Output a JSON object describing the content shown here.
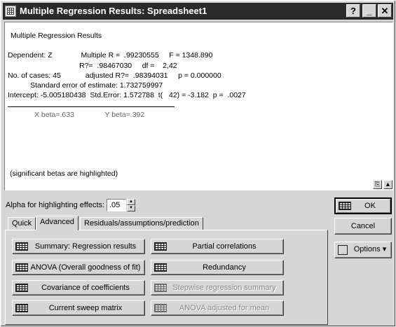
{
  "window": {
    "title": "Multiple Regression Results: Spreadsheet1"
  },
  "titlebar_buttons": {
    "help": "?",
    "minimize": "_",
    "close": "✕"
  },
  "output": {
    "heading": "Multiple Regression Results",
    "line1": "Dependent: Z              Multiple R =  .99230555     F = 1348.890",
    "line2": "                                   R?=  .98467030     df =    2,42",
    "line3": "No. of cases: 45            adjusted R?=  .98394031     p = 0.000000",
    "line4": "           Standard error of estimate: 1.732759997",
    "line5": "Intercept: -5.005180438  Std.Error: 1.572788  t(   42) = -3.182  p =  .0027",
    "betas": "X beta=.633               Y beta=.392",
    "footnote": "(significant betas are highlighted)"
  },
  "alpha": {
    "label": "Alpha for highlighting effects:",
    "value": ".05"
  },
  "tabs": [
    {
      "label": "Quick"
    },
    {
      "label": "Advanced"
    },
    {
      "label": "Residuals/assumptions/prediction"
    }
  ],
  "buttons": {
    "summary": "Summary:  Regression results",
    "partial": "Partial correlations",
    "anova": "ANOVA (Overall goodness of fit)",
    "redundancy": "Redundancy",
    "covariance": "Covariance of coefficients",
    "stepwise": "Stepwise regression summary",
    "sweep": "Current sweep matrix",
    "anova_adj": "ANOVA adjusted for mean",
    "ok": "OK",
    "cancel": "Cancel",
    "options": "Options"
  }
}
